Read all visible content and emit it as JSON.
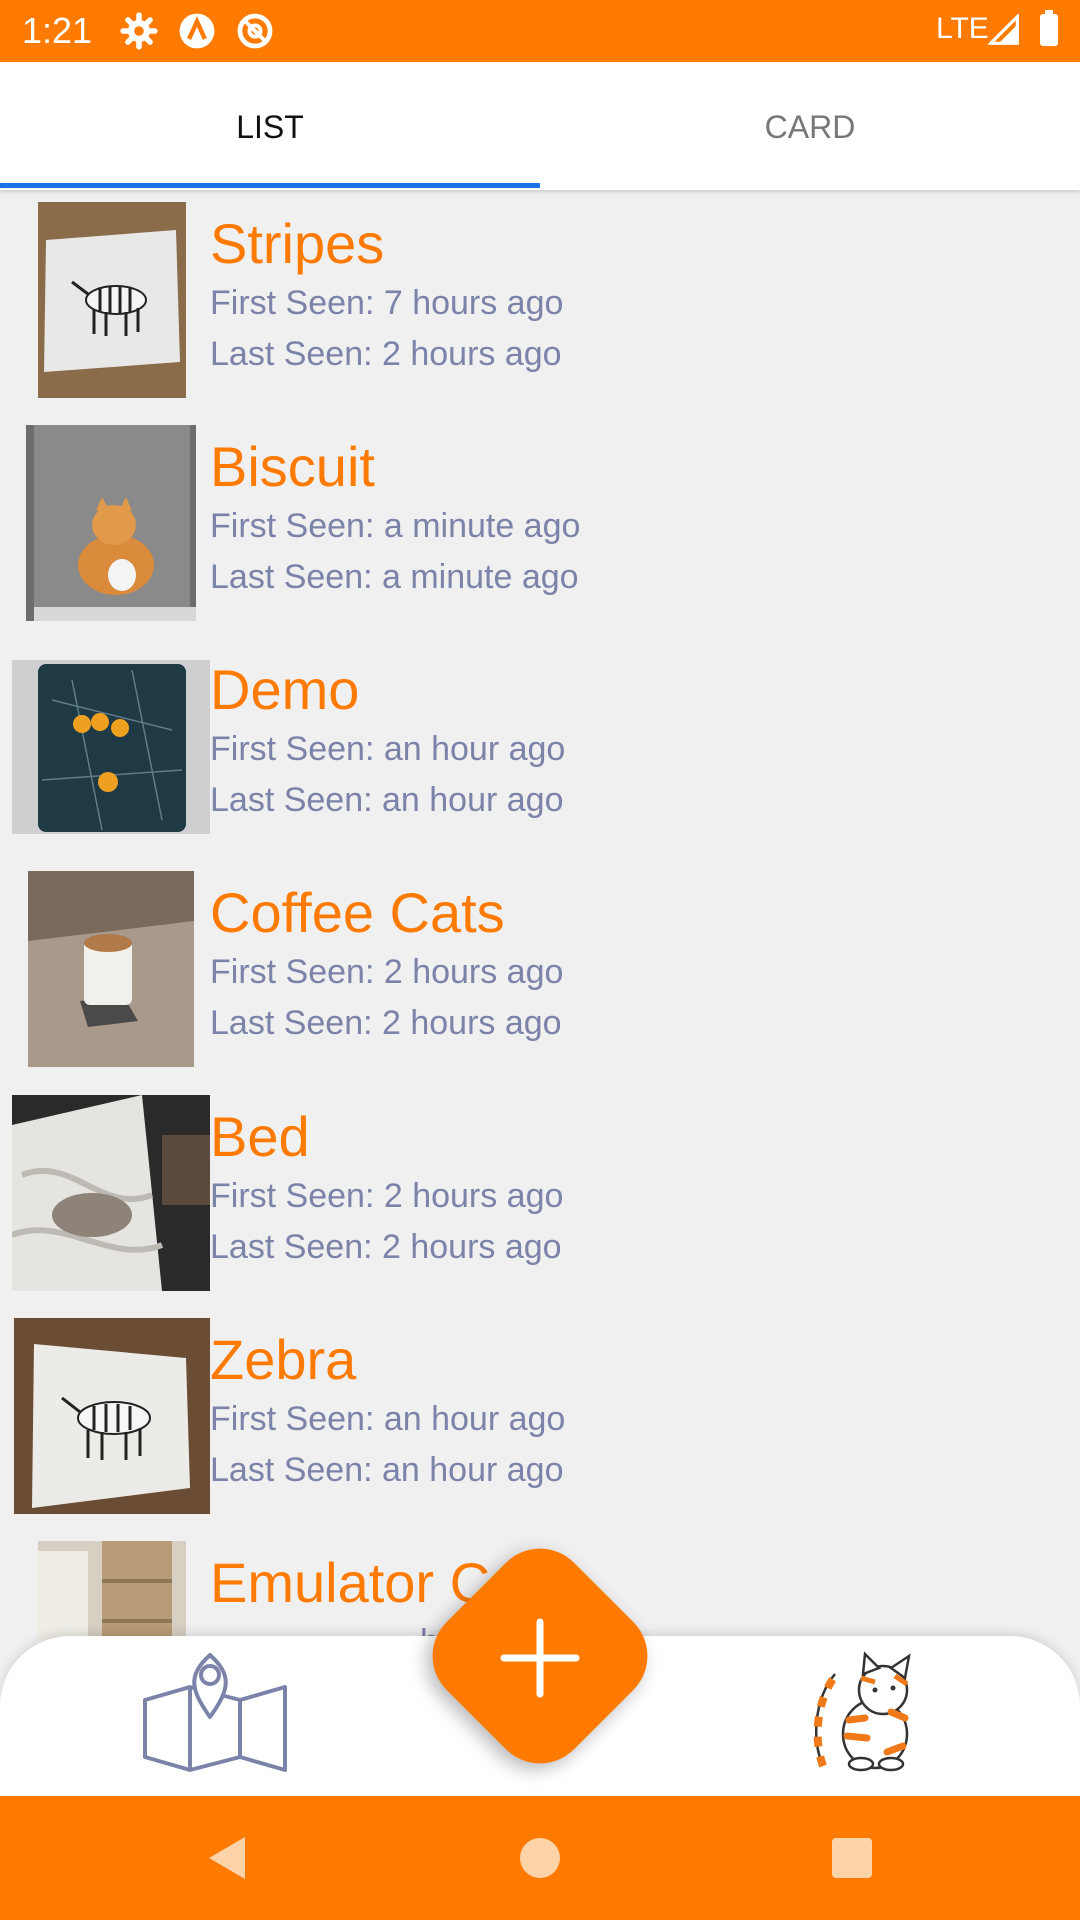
{
  "status_bar": {
    "time": "1:21",
    "network": "LTE"
  },
  "tabs": {
    "list": "LIST",
    "card": "CARD"
  },
  "items": [
    {
      "title": "Stripes",
      "first_seen": "First Seen: 7 hours ago",
      "last_seen": "Last Seen: 2 hours ago",
      "thumbnail": "zebra-photo"
    },
    {
      "title": "Biscuit",
      "first_seen": "First Seen: a minute ago",
      "last_seen": "Last Seen: a minute ago",
      "thumbnail": "orange-cat-window-photo"
    },
    {
      "title": "Demo",
      "first_seen": "First Seen: an hour ago",
      "last_seen": "Last Seen: an hour ago",
      "thumbnail": "map-screen-photo"
    },
    {
      "title": "Coffee Cats",
      "first_seen": "First Seen: 2 hours ago",
      "last_seen": "Last Seen: 2 hours ago",
      "thumbnail": "coffee-cup-photo"
    },
    {
      "title": "Bed",
      "first_seen": "First Seen: 2 hours ago",
      "last_seen": "Last Seen: 2 hours ago",
      "thumbnail": "bed-photo"
    },
    {
      "title": "Zebra",
      "first_seen": "First Seen: an hour ago",
      "last_seen": "Last Seen: an hour ago",
      "thumbnail": "zebra-photo"
    },
    {
      "title": "Emulator Ca",
      "first_seen": "h",
      "last_seen": "ou",
      "thumbnail": "room-photo"
    }
  ],
  "bottom_nav": {
    "left_icon": "map-icon",
    "center_icon": "add-icon",
    "right_icon": "cat-icon"
  },
  "colors": {
    "accent": "#ff7a00",
    "tab_indicator": "#1a73e8",
    "subtitle": "#7b83a9",
    "background": "#f0f0f0"
  }
}
